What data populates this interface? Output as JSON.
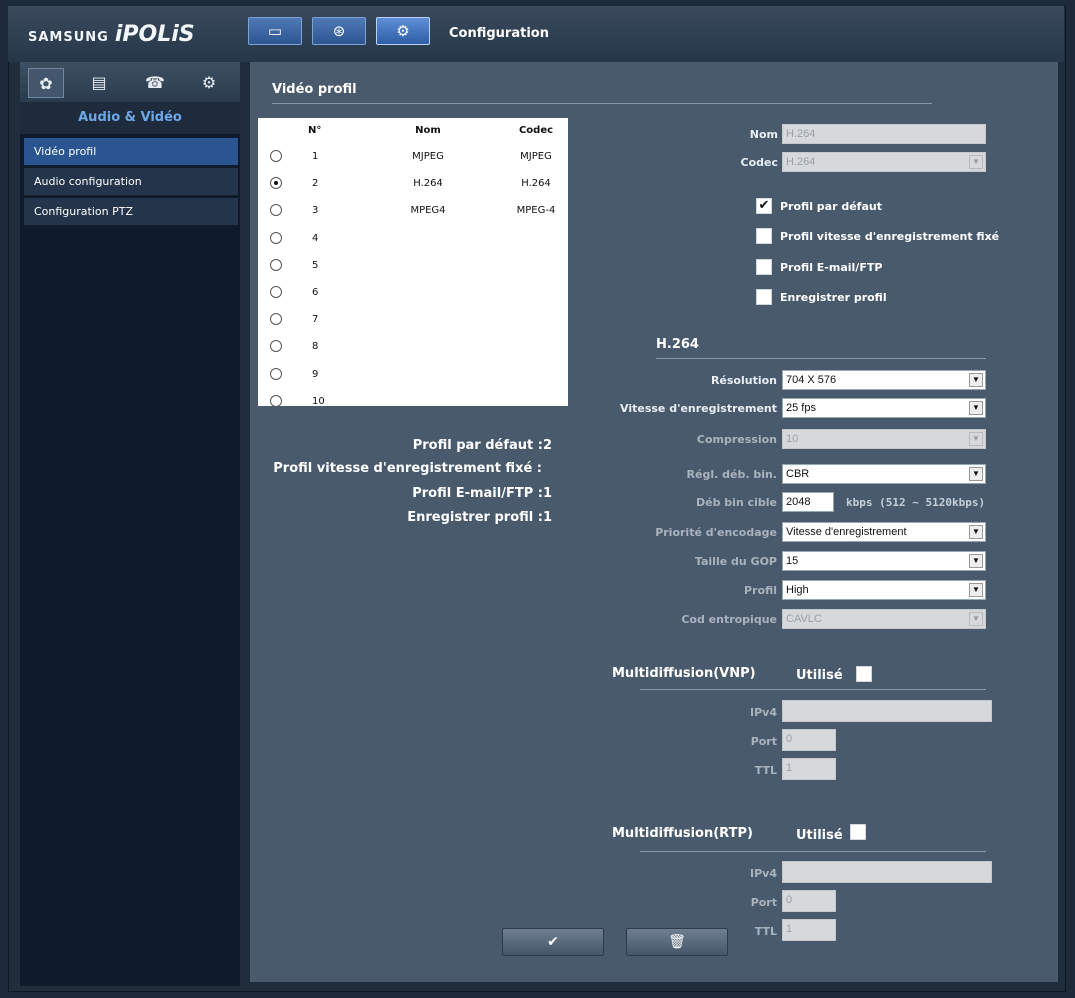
{
  "header": {
    "brand_prefix": "SAMSUNG",
    "brand_name": "iPOLiS",
    "breadcrumb": "Configuration",
    "toolbar": [
      {
        "icon": "monitor-icon",
        "glyph": "▭"
      },
      {
        "icon": "ptz-icon",
        "glyph": "⊛"
      },
      {
        "icon": "gear-icon",
        "glyph": "⚙"
      }
    ]
  },
  "sidebar": {
    "tabs": [
      {
        "icon": "camera-settings-icon",
        "glyph": "✿"
      },
      {
        "icon": "network-icon",
        "glyph": "▤"
      },
      {
        "icon": "alarm-icon",
        "glyph": "☎"
      },
      {
        "icon": "system-gear-icon",
        "glyph": "⚙"
      }
    ],
    "heading": "Audio & Vidéo",
    "items": [
      {
        "label": "Vidéo profil"
      },
      {
        "label": "Audio configuration"
      },
      {
        "label": "Configuration PTZ"
      }
    ]
  },
  "page": {
    "title": "Vidéo profil"
  },
  "profile_table": {
    "headers": {
      "num": "N°",
      "name": "Nom",
      "codec": "Codec"
    },
    "rows": [
      {
        "num": "1",
        "name": "MJPEG",
        "codec": "MJPEG"
      },
      {
        "num": "2",
        "name": "H.264",
        "codec": "H.264"
      },
      {
        "num": "3",
        "name": "MPEG4",
        "codec": "MPEG-4"
      },
      {
        "num": "4",
        "name": "",
        "codec": ""
      },
      {
        "num": "5",
        "name": "",
        "codec": ""
      },
      {
        "num": "6",
        "name": "",
        "codec": ""
      },
      {
        "num": "7",
        "name": "",
        "codec": ""
      },
      {
        "num": "8",
        "name": "",
        "codec": ""
      },
      {
        "num": "9",
        "name": "",
        "codec": ""
      },
      {
        "num": "10",
        "name": "",
        "codec": ""
      }
    ],
    "selected": "2"
  },
  "summary": {
    "default": "Profil par défaut :2",
    "fixed_rate": "Profil vitesse d'enregistrement fixé :",
    "email_ftp": "Profil E-mail/FTP :1",
    "record": "Enregistrer profil :1"
  },
  "profile_form": {
    "nom_label": "Nom",
    "nom_value": "H.264",
    "codec_label": "Codec",
    "codec_value": "H.264",
    "checkboxes": [
      {
        "label": "Profil par défaut",
        "checked": true
      },
      {
        "label": "Profil vitesse d'enregistrement fixé",
        "checked": false
      },
      {
        "label": "Profil E-mail/FTP",
        "checked": false
      },
      {
        "label": "Enregistrer profil",
        "checked": false
      }
    ]
  },
  "h264": {
    "title": "H.264",
    "resolution_label": "Résolution",
    "resolution_value": "704 X 576",
    "rate_label": "Vitesse d'enregistrement",
    "rate_value": "25 fps",
    "compression_label": "Compression",
    "compression_value": "10",
    "bitrate_ctrl_label": "Régl. déb. bin.",
    "bitrate_ctrl_value": "CBR",
    "target_label": "Déb bin cible",
    "target_value": "2048",
    "target_hint": "kbps (512 ~ 5120kbps)",
    "priority_label": "Priorité d'encodage",
    "priority_value": "Vitesse d'enregistrement",
    "gop_label": "Taille du GOP",
    "gop_value": "15",
    "profile_label": "Profil",
    "profile_value": "High",
    "entropy_label": "Cod entropique",
    "entropy_value": "CAVLC"
  },
  "multicast_vnp": {
    "title": "Multidiffusion(VNP)",
    "used_label": "Utilisé",
    "ipv4_label": "IPv4",
    "ipv4_value": "",
    "port_label": "Port",
    "port_value": "0",
    "ttl_label": "TTL",
    "ttl_value": "1"
  },
  "multicast_rtp": {
    "title": "Multidiffusion(RTP)",
    "used_label": "Utilisé",
    "ipv4_label": "IPv4",
    "ipv4_value": "",
    "port_label": "Port",
    "port_value": "0",
    "ttl_label": "TTL",
    "ttl_value": "1"
  },
  "actions": {
    "apply_glyph": "✔",
    "delete_glyph": "🗑"
  }
}
